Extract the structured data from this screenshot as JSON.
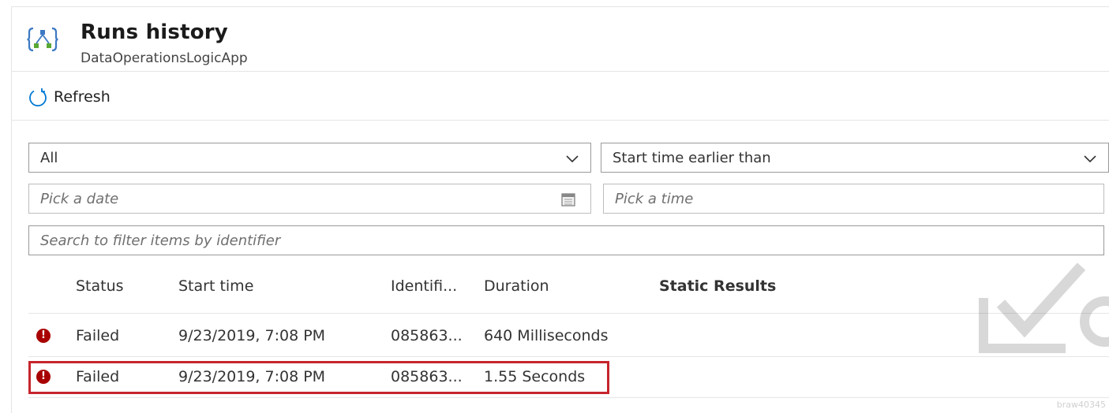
{
  "header": {
    "title": "Runs history",
    "subtitle": "DataOperationsLogicApp"
  },
  "toolbar": {
    "refresh_label": "Refresh"
  },
  "filters": {
    "status_value": "All",
    "time_filter_value": "Start time earlier than",
    "date_placeholder": "Pick a date",
    "time_placeholder": "Pick a time",
    "search_placeholder": "Search to filter items by identifier"
  },
  "table": {
    "columns": [
      "Status",
      "Start time",
      "Identifi...",
      "Duration",
      "Static Results"
    ],
    "rows": [
      {
        "status": "Failed",
        "start_time": "9/23/2019, 7:08 PM",
        "identifier": "085863...",
        "duration": "640 Milliseconds",
        "static_results": ""
      },
      {
        "status": "Failed",
        "start_time": "9/23/2019, 7:08 PM",
        "identifier": "085863...",
        "duration": "1.55 Seconds",
        "static_results": ""
      }
    ]
  },
  "colors": {
    "error": "#a80000",
    "highlight": "#c6252d",
    "logo_green": "#59a834",
    "logo_blue": "#3c79c3"
  },
  "watermark": {
    "text": "braw40345"
  }
}
